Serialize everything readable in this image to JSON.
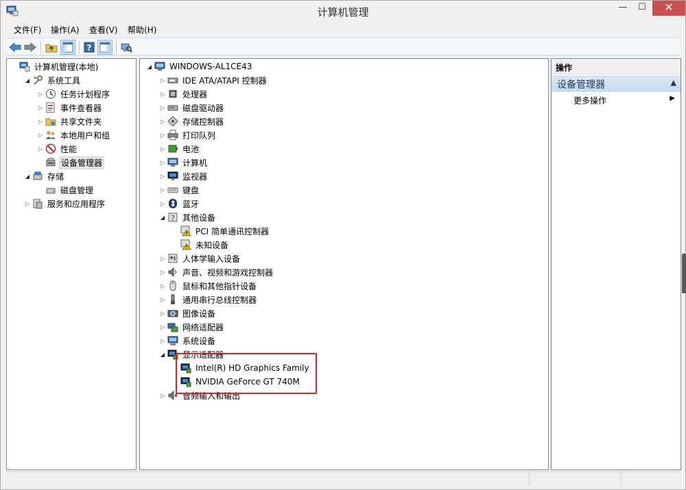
{
  "window": {
    "title": "计算机管理"
  },
  "menu": [
    "文件(F)",
    "操作(A)",
    "查看(V)",
    "帮助(H)"
  ],
  "left_tree": [
    {
      "label": "计算机管理(本地)",
      "icon": "computer-management-icon",
      "expander": "",
      "depth": 0
    },
    {
      "label": "系统工具",
      "icon": "tools-icon",
      "expander": "open",
      "depth": 1
    },
    {
      "label": "任务计划程序",
      "icon": "clock-icon",
      "expander": "closed",
      "depth": 2
    },
    {
      "label": "事件查看器",
      "icon": "event-viewer-icon",
      "expander": "closed",
      "depth": 2
    },
    {
      "label": "共享文件夹",
      "icon": "shared-folder-icon",
      "expander": "closed",
      "depth": 2
    },
    {
      "label": "本地用户和组",
      "icon": "users-icon",
      "expander": "closed",
      "depth": 2
    },
    {
      "label": "性能",
      "icon": "performance-icon",
      "expander": "closed",
      "depth": 2
    },
    {
      "label": "设备管理器",
      "icon": "device-manager-icon",
      "expander": "",
      "depth": 2,
      "selected": true
    },
    {
      "label": "存储",
      "icon": "storage-icon",
      "expander": "open",
      "depth": 1
    },
    {
      "label": "磁盘管理",
      "icon": "disk-management-icon",
      "expander": "",
      "depth": 2
    },
    {
      "label": "服务和应用程序",
      "icon": "services-icon",
      "expander": "closed",
      "depth": 1
    }
  ],
  "device_tree": [
    {
      "label": "WINDOWS-AL1CE43",
      "icon": "computer-icon",
      "expander": "open",
      "depth": 0
    },
    {
      "label": "IDE ATA/ATAPI 控制器",
      "icon": "ide-controller-icon",
      "expander": "closed",
      "depth": 1
    },
    {
      "label": "处理器",
      "icon": "processor-icon",
      "expander": "closed",
      "depth": 1
    },
    {
      "label": "磁盘驱动器",
      "icon": "disk-drive-icon",
      "expander": "closed",
      "depth": 1
    },
    {
      "label": "存储控制器",
      "icon": "storage-controller-icon",
      "expander": "closed",
      "depth": 1
    },
    {
      "label": "打印队列",
      "icon": "printer-icon",
      "expander": "closed",
      "depth": 1
    },
    {
      "label": "电池",
      "icon": "battery-icon",
      "expander": "closed",
      "depth": 1
    },
    {
      "label": "计算机",
      "icon": "computer-icon",
      "expander": "closed",
      "depth": 1
    },
    {
      "label": "监视器",
      "icon": "monitor-icon",
      "expander": "closed",
      "depth": 1
    },
    {
      "label": "键盘",
      "icon": "keyboard-icon",
      "expander": "closed",
      "depth": 1
    },
    {
      "label": "蓝牙",
      "icon": "bluetooth-icon",
      "expander": "closed",
      "depth": 1
    },
    {
      "label": "其他设备",
      "icon": "other-devices-icon",
      "expander": "open",
      "depth": 1
    },
    {
      "label": "PCI 简单通讯控制器",
      "icon": "warning-device-icon",
      "expander": "",
      "depth": 2
    },
    {
      "label": "未知设备",
      "icon": "warning-device-icon",
      "expander": "",
      "depth": 2
    },
    {
      "label": "人体学输入设备",
      "icon": "hid-icon",
      "expander": "closed",
      "depth": 1
    },
    {
      "label": "声音、视频和游戏控制器",
      "icon": "speaker-icon",
      "expander": "closed",
      "depth": 1
    },
    {
      "label": "鼠标和其他指针设备",
      "icon": "mouse-icon",
      "expander": "closed",
      "depth": 1
    },
    {
      "label": "通用串行总线控制器",
      "icon": "usb-icon",
      "expander": "closed",
      "depth": 1
    },
    {
      "label": "图像设备",
      "icon": "camera-icon",
      "expander": "closed",
      "depth": 1
    },
    {
      "label": "网络适配器",
      "icon": "network-adapter-icon",
      "expander": "closed",
      "depth": 1
    },
    {
      "label": "系统设备",
      "icon": "system-device-icon",
      "expander": "closed",
      "depth": 1
    },
    {
      "label": "显示适配器",
      "icon": "display-adapter-icon",
      "expander": "open",
      "depth": 1
    },
    {
      "label": "Intel(R) HD Graphics Family",
      "icon": "display-adapter-icon",
      "expander": "",
      "depth": 2
    },
    {
      "label": "NVIDIA GeForce GT 740M",
      "icon": "display-adapter-icon",
      "expander": "",
      "depth": 2
    },
    {
      "label": "音频输入和输出",
      "icon": "audio-io-icon",
      "expander": "closed",
      "depth": 1
    }
  ],
  "actions": {
    "header": "操作",
    "section": "设备管理器",
    "more": "更多操作"
  },
  "colors": {
    "highlight": "#e02020",
    "close_button": "#c75050",
    "section_header": "#1e395b"
  }
}
